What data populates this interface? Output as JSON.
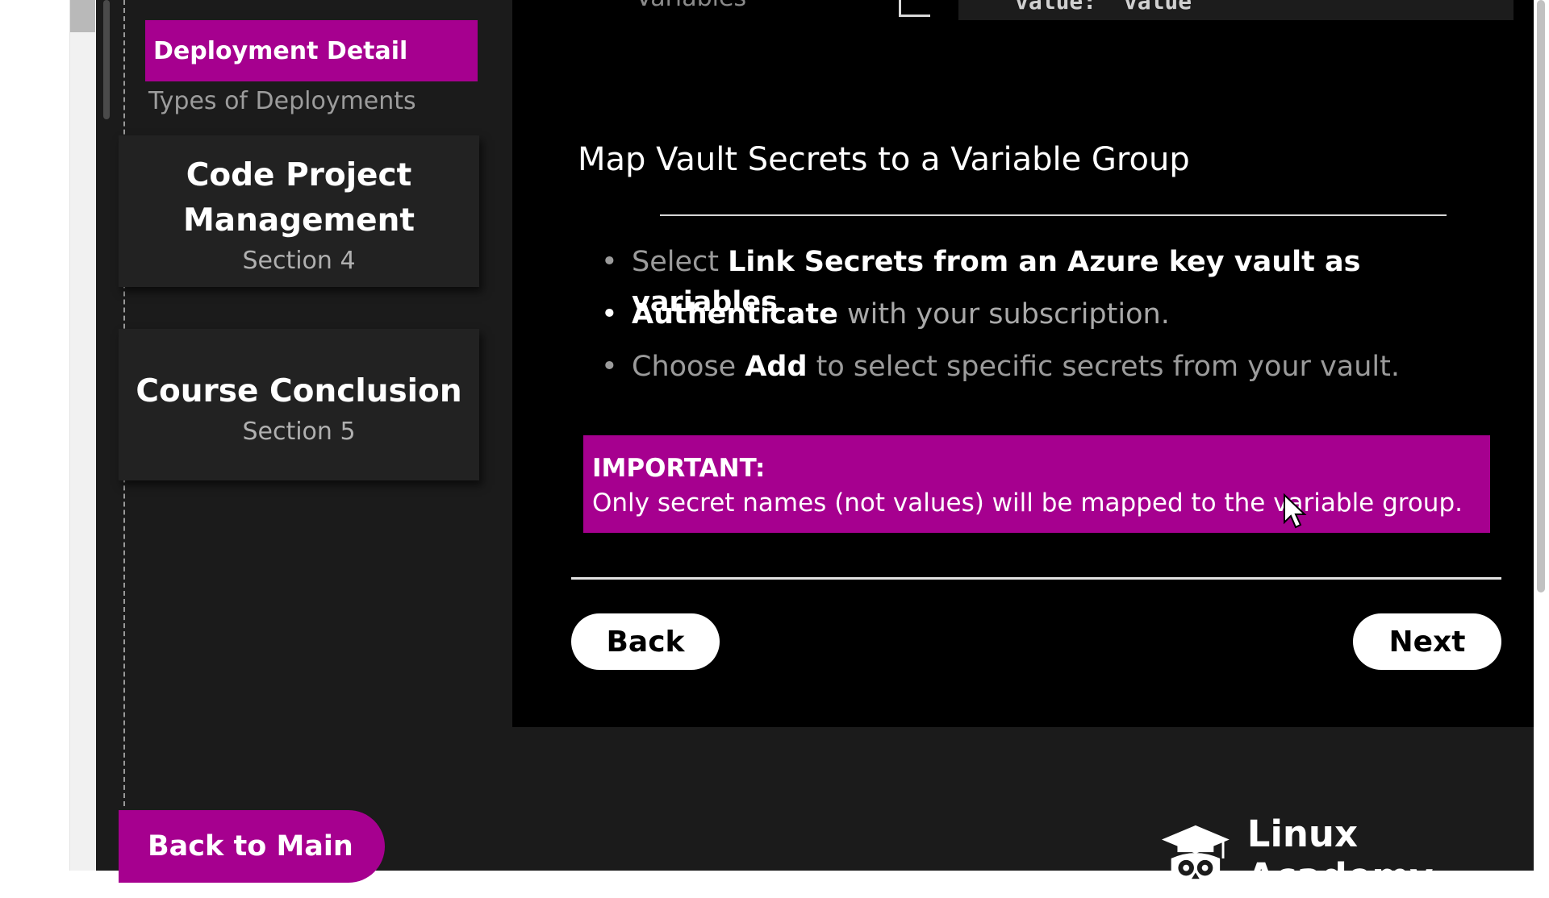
{
  "sidebar": {
    "active_item": "Deployment Detail",
    "sub_item": "Types of Deployments",
    "sections": [
      {
        "title_line1": "Code Project",
        "title_line2": "Management",
        "subtitle": "Section 4"
      },
      {
        "title": "Course Conclusion",
        "subtitle": "Section 5"
      }
    ],
    "back_to_main": "Back to Main"
  },
  "top": {
    "partial_label": "Variables",
    "code_snippet": "value: \"value\""
  },
  "slide": {
    "title": "Map Vault Secrets to a Variable Group",
    "bullets": [
      {
        "pre": "Select ",
        "bold": "Link Secrets from an Azure key vault as variables",
        "post": "."
      },
      {
        "pre": "",
        "bold": "Authenticate",
        "post": " with your subscription."
      },
      {
        "pre": "Choose ",
        "bold": "Add",
        "post": " to select specific secrets from your vault."
      }
    ],
    "important_heading": "IMPORTANT:",
    "important_text": "Only secret names (not values) will be mapped to the variable group."
  },
  "nav": {
    "back": "Back",
    "next": "Next"
  },
  "brand": {
    "name": "Linux Academy",
    "icon": "owl-graduation-cap-icon"
  },
  "colors": {
    "accent": "#a6008f",
    "content_bg": "#000000",
    "sidebar_bg": "#1b1b1b"
  }
}
